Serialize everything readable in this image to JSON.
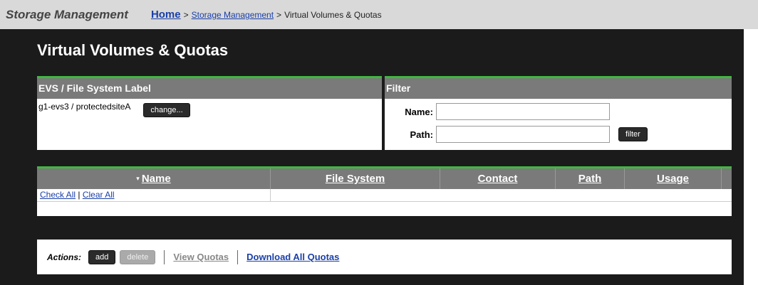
{
  "header": {
    "app_title": "Storage Management",
    "breadcrumb": {
      "home": "Home",
      "sep1": ">",
      "storage": "Storage Management",
      "sep2": ">",
      "current": "Virtual Volumes & Quotas"
    }
  },
  "page": {
    "title": "Virtual Volumes & Quotas"
  },
  "evs_panel": {
    "header": "EVS / File System Label",
    "value": "g1-evs3 /  protectedsiteA",
    "change_label": "change..."
  },
  "filter_panel": {
    "header": "Filter",
    "name_label": "Name:",
    "name_value": "",
    "path_label": "Path:",
    "path_value": "",
    "filter_label": "filter"
  },
  "table": {
    "columns": [
      "Name",
      "File System",
      "Contact",
      "Path",
      "Usage"
    ],
    "sort_indicator": "▾",
    "check_all": "Check All",
    "divider": "|",
    "clear_all": "Clear All"
  },
  "actions": {
    "label": "Actions:",
    "add": "add",
    "delete": "delete",
    "view_quotas": "View Quotas",
    "download_all": "Download All Quotas"
  }
}
